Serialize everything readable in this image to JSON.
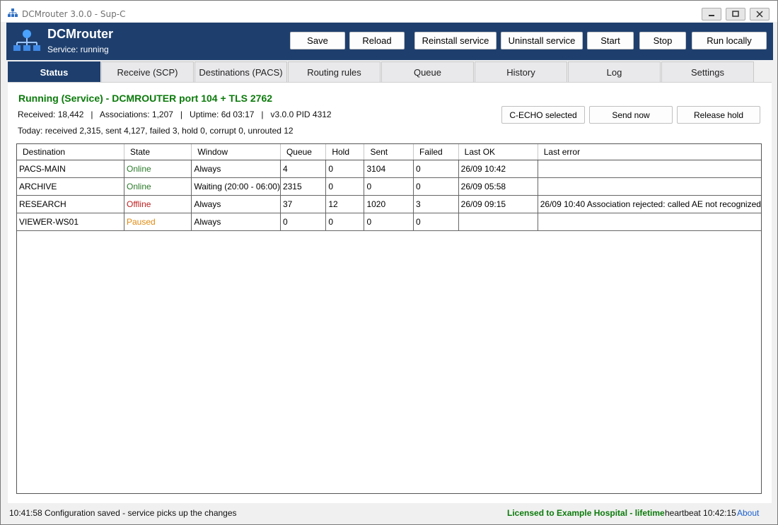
{
  "window": {
    "title": "DCMrouter 3.0.0 - Sup-C"
  },
  "header": {
    "app_name": "DCMrouter",
    "service_status": "Service: running",
    "buttons": {
      "save": "Save",
      "reload": "Reload",
      "reinstall": "Reinstall service",
      "uninstall": "Uninstall service",
      "start": "Start",
      "stop": "Stop",
      "run_locally": "Run locally"
    }
  },
  "tabs": [
    {
      "label": "Status",
      "active": true
    },
    {
      "label": "Receive (SCP)"
    },
    {
      "label": "Destinations (PACS)"
    },
    {
      "label": "Routing rules"
    },
    {
      "label": "Queue"
    },
    {
      "label": "History"
    },
    {
      "label": "Log"
    },
    {
      "label": "Settings"
    }
  ],
  "status": {
    "heading": "Running (Service) - DCMROUTER port 104 + TLS 2762",
    "stats_line": "Received: 18,442   |   Associations: 1,207   |   Uptime: 6d 03:17   |   v3.0.0 PID 4312",
    "today_line": "Today: received 2,315, sent 4,127, failed 3, hold 0, corrupt 0, unrouted 12",
    "actions": {
      "echo": "C-ECHO selected",
      "send_now": "Send now",
      "release_hold": "Release hold"
    }
  },
  "table": {
    "columns": [
      "Destination",
      "State",
      "Window",
      "Queue",
      "Hold",
      "Sent",
      "Failed",
      "Last OK",
      "Last error"
    ],
    "rows": [
      [
        "PACS-MAIN",
        "Online",
        "Always",
        "4",
        "0",
        "3104",
        "0",
        "26/09 10:42",
        ""
      ],
      [
        "ARCHIVE",
        "Online",
        "Waiting (20:00 - 06:00)",
        "2315",
        "0",
        "0",
        "0",
        "26/09 05:58",
        ""
      ],
      [
        "RESEARCH",
        "Offline",
        "Always",
        "37",
        "12",
        "1020",
        "3",
        "26/09 09:15",
        "26/09 10:40 Association rejected: called AE not recognized"
      ],
      [
        "VIEWER-WS01",
        "Paused",
        "Always",
        "0",
        "0",
        "0",
        "0",
        "",
        ""
      ]
    ]
  },
  "statusbar": {
    "message": "10:41:58  Configuration saved - service picks up the changes",
    "license": "Licensed to Example Hospital - lifetime",
    "heartbeat": "heartbeat 10:42:15",
    "about": "About"
  },
  "colors": {
    "header_bg": "#1e3f6e",
    "running": "#0b7a0b",
    "online": "#2a7a2a",
    "offline": "#c02020",
    "paused": "#e08a10",
    "link": "#1a5fd0"
  },
  "icons": {
    "app": "network-tree-icon",
    "logo": "network-tree-logo-icon"
  }
}
